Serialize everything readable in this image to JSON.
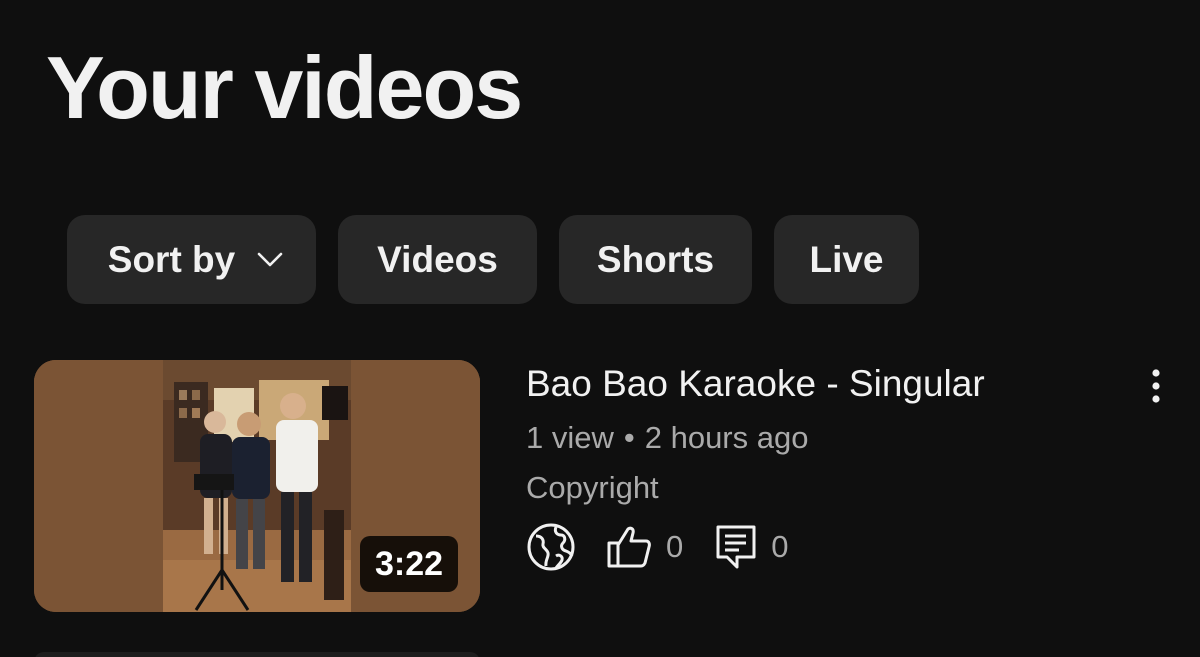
{
  "page": {
    "title": "Your videos"
  },
  "filters": {
    "sort_label": "Sort by",
    "chips": [
      "Videos",
      "Shorts",
      "Live"
    ]
  },
  "video": {
    "title": "Bao Bao Karaoke - Singular",
    "views": "1 view",
    "separator": "•",
    "age": "2 hours ago",
    "license": "Copyright",
    "duration": "3:22",
    "visibility_icon": "globe-icon",
    "likes": "0",
    "comments": "0"
  },
  "colors": {
    "background": "#0f0f0f",
    "chip_bg": "#272727",
    "primary_text": "#f1f1f1",
    "secondary_text": "#aaaaaa",
    "thumb_sidebar": "#7a5334"
  }
}
